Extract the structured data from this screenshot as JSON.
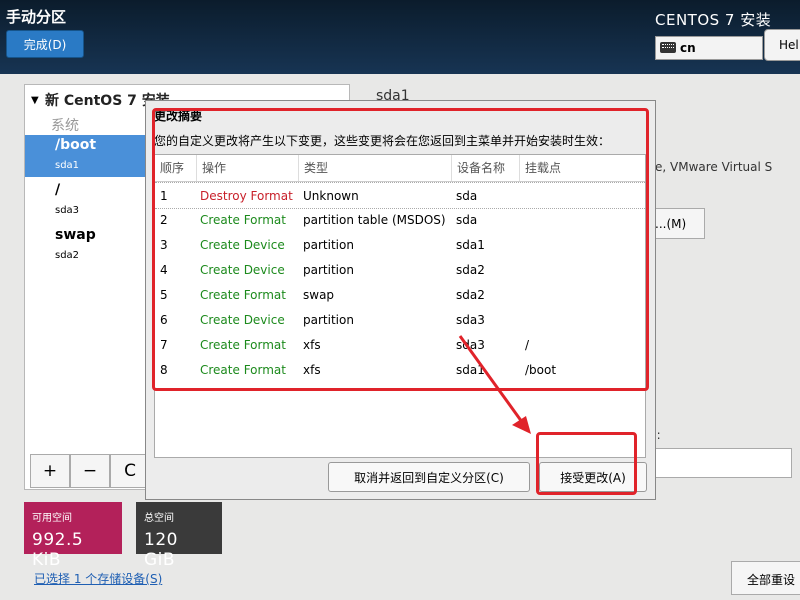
{
  "header": {
    "page_title": "手动分区",
    "done_button": "完成(D)",
    "install_title": "CENTOS 7 安装",
    "keyboard_layout": "cn",
    "help_button": "Hel"
  },
  "left_panel": {
    "root_label": "新 CentOS 7 安装",
    "section_label": "系统",
    "mount_points": [
      {
        "name": "/boot",
        "device": "sda1"
      },
      {
        "name": "/",
        "device": "sda3"
      },
      {
        "name": "swap",
        "device": "sda2"
      }
    ],
    "tools": {
      "add": "+",
      "remove": "−",
      "refresh": "C"
    }
  },
  "space": {
    "available_label": "可用空间",
    "available_value": "992.5 KiB",
    "total_label": "总空间",
    "total_value": "120 GiB"
  },
  "storage_link": "已选择 1 个存储设备(S)",
  "right_panel": {
    "device_title": "sda1",
    "device_desc": "e, VMware Virtual S",
    "modify_button": "...(M)",
    "label_colon": "):",
    "reset_button": "全部重设"
  },
  "dialog": {
    "title": "更改摘要",
    "description": "您的自定义更改将产生以下变更，这些变更将会在您返回到主菜单并开始安装时生效：",
    "columns": [
      "顺序",
      "操作",
      "类型",
      "设备名称",
      "挂载点"
    ],
    "rows": [
      {
        "order": "1",
        "action": "Destroy Format",
        "type": "Unknown",
        "device": "sda",
        "mount": ""
      },
      {
        "order": "2",
        "action": "Create Format",
        "type": "partition table (MSDOS)",
        "device": "sda",
        "mount": ""
      },
      {
        "order": "3",
        "action": "Create Device",
        "type": "partition",
        "device": "sda1",
        "mount": ""
      },
      {
        "order": "4",
        "action": "Create Device",
        "type": "partition",
        "device": "sda2",
        "mount": ""
      },
      {
        "order": "5",
        "action": "Create Format",
        "type": "swap",
        "device": "sda2",
        "mount": ""
      },
      {
        "order": "6",
        "action": "Create Device",
        "type": "partition",
        "device": "sda3",
        "mount": ""
      },
      {
        "order": "7",
        "action": "Create Format",
        "type": "xfs",
        "device": "sda3",
        "mount": "/"
      },
      {
        "order": "8",
        "action": "Create Format",
        "type": "xfs",
        "device": "sda1",
        "mount": "/boot"
      }
    ],
    "cancel_button": "取消并返回到自定义分区(C)",
    "accept_button": "接受更改(A)"
  },
  "colors": {
    "header_bg": "#173453",
    "selected_row": "#4a90d9",
    "available_space_bg": "#b3215a",
    "total_space_bg": "#3a3a3a",
    "destroy_action": "#c8202a",
    "create_action": "#1c8a1c",
    "annotation": "#e0232a"
  }
}
